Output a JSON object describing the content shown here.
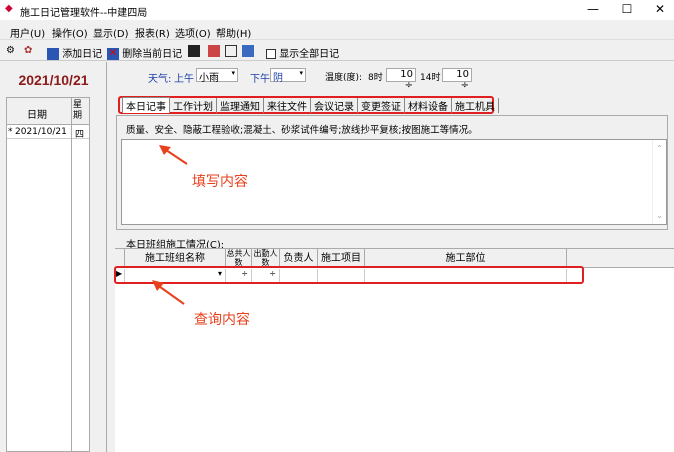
{
  "window": {
    "title": "施工日记管理软件--中建四局",
    "minimize": "—",
    "maximize": "☐",
    "close": "✕"
  },
  "menu": [
    "用户(U)",
    "操作(O)",
    "显示(D)",
    "报表(R)",
    "选项(O)",
    "帮助(H)"
  ],
  "toolbar": {
    "add": "添加日记",
    "delete": "删除当前日记",
    "show_all": "显示全部日记"
  },
  "left": {
    "date": "2021/10/21",
    "col_date": "日期",
    "col_week": "星期",
    "rows": [
      {
        "marker": "*",
        "date": "2021/10/21",
        "week": "四"
      }
    ]
  },
  "weather": {
    "label": "天气:",
    "am": "上午",
    "am_value": "小雨",
    "pm": "下午",
    "pm_value": "阴",
    "temp_label": "温度(度):",
    "t8": "8时",
    "t8_value": "10",
    "t14": "14时",
    "t14_value": "10"
  },
  "tabs": [
    "本日记事",
    "工作计划",
    "监理通知",
    "来往文件",
    "会议记录",
    "变更签证",
    "材料设备",
    "施工机具"
  ],
  "hint": "质量、安全、隐蔽工程验收;混凝土、砂浆试件编号;放线抄平复核;按图施工等情况。",
  "annotations": {
    "fill": "填写内容",
    "query": "查询内容"
  },
  "group": {
    "label": "本日班组施工情况(C):",
    "columns": [
      "施工班组名称",
      "总共人数",
      "出勤人数",
      "负责人",
      "施工项目",
      "施工部位"
    ]
  }
}
